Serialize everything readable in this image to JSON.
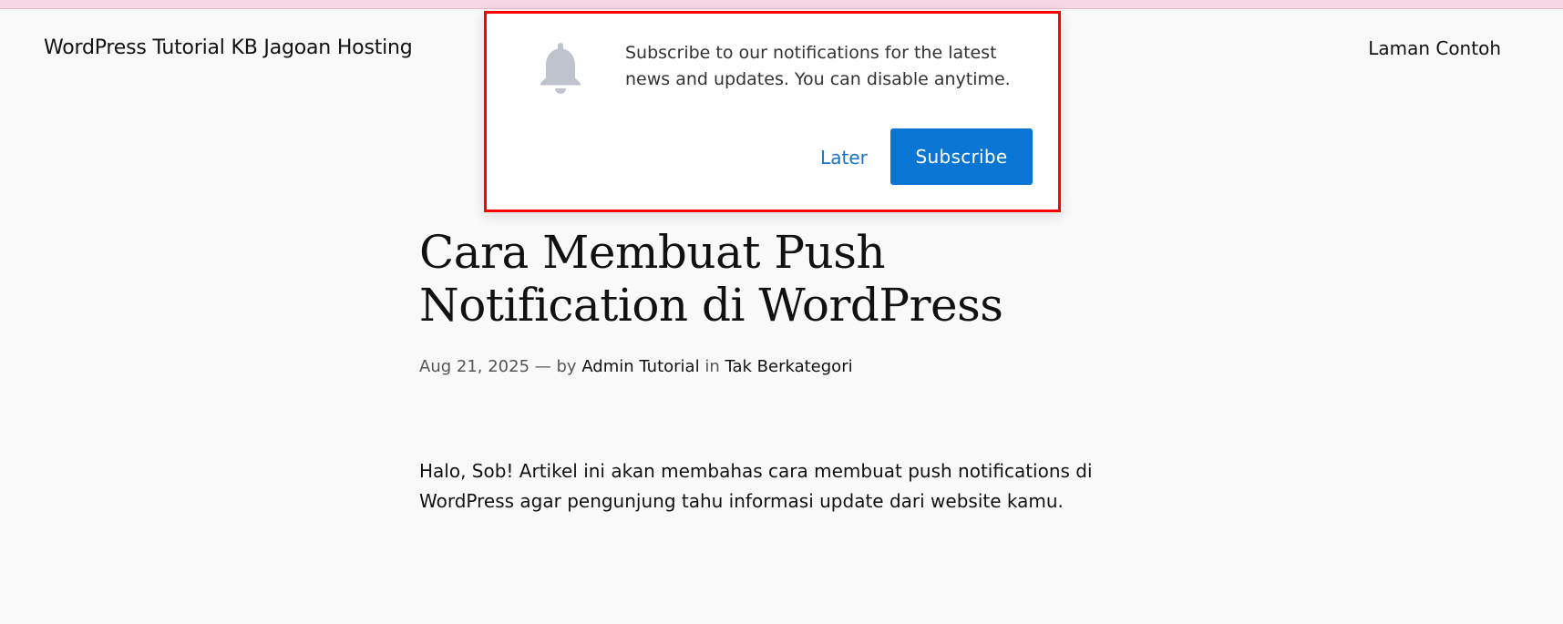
{
  "header": {
    "site_title": "WordPress Tutorial KB Jagoan Hosting",
    "nav_link": "Laman Contoh"
  },
  "notification_prompt": {
    "icon": "bell-icon",
    "message": "Subscribe to our notifications for the latest news and updates. You can disable anytime.",
    "later_label": "Later",
    "subscribe_label": "Subscribe",
    "accent_color": "#0a76d3",
    "highlight_color": "#ff0000"
  },
  "post": {
    "title": "Cara Membuat Push Notification di WordPress",
    "date": "Aug 21, 2025",
    "by_text": "— by",
    "author": "Admin Tutorial",
    "in_text": "in",
    "category": "Tak Berkategori",
    "excerpt": "Halo, Sob! Artikel ini akan membahas cara membuat push notifications di WordPress agar pengunjung tahu informasi update dari website kamu."
  }
}
